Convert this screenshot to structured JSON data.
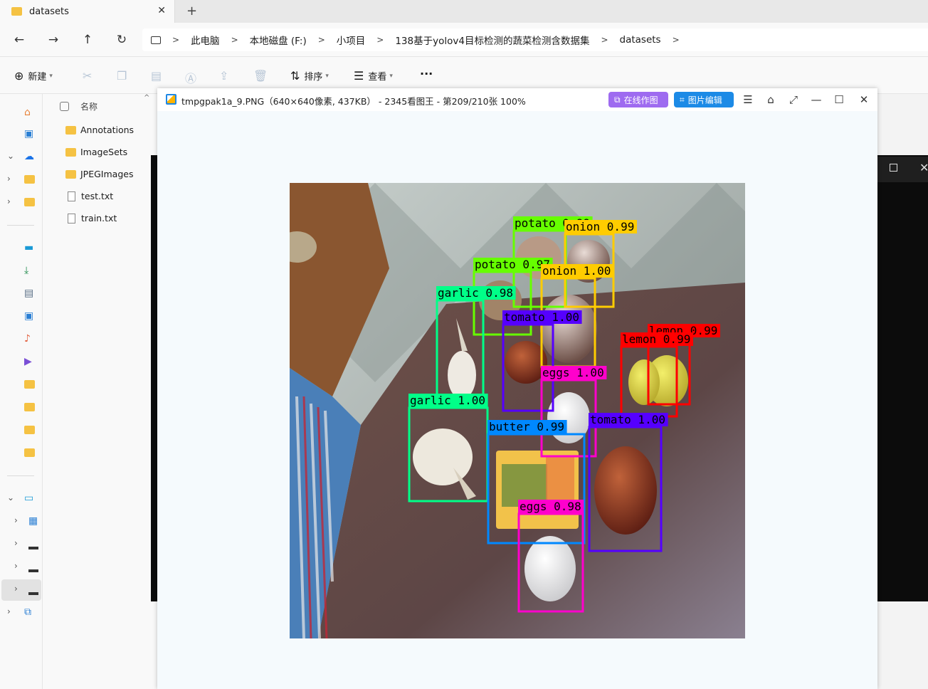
{
  "explorer": {
    "tab_title": "datasets",
    "breadcrumb": [
      "此电脑",
      "本地磁盘 (F:)",
      "小项目",
      "138基于yolov4目标检测的蔬菜检测含数据集",
      "datasets"
    ],
    "commands": {
      "new": "新建",
      "sort": "排序",
      "view": "查看",
      "more": "···"
    },
    "column_name": "名称",
    "files": [
      {
        "name": "Annotations",
        "type": "folder"
      },
      {
        "name": "ImageSets",
        "type": "folder"
      },
      {
        "name": "JPEGImages",
        "type": "folder"
      },
      {
        "name": "test.txt",
        "type": "file"
      },
      {
        "name": "train.txt",
        "type": "file"
      }
    ]
  },
  "viewer": {
    "title": "tmpgpak1a_9.PNG（640×640像素, 437KB） - 2345看图王 - 第209/210张 100%",
    "online_edit": "在线作图",
    "image_edit": "图片编辑"
  },
  "detections": [
    {
      "label": "potato 0.99",
      "color": "#66ff00"
    },
    {
      "label": "onion 0.99",
      "color": "#ffcc00"
    },
    {
      "label": "potato 0.97",
      "color": "#66ff00"
    },
    {
      "label": "onion 1.00",
      "color": "#ffcc00"
    },
    {
      "label": "garlic 0.98",
      "color": "#00ff88"
    },
    {
      "label": "tomato 1.00",
      "color": "#5500ff"
    },
    {
      "label": "lemon 0.99",
      "color": "#ff0000"
    },
    {
      "label": "lemon 0.99",
      "color": "#ff0000"
    },
    {
      "label": "eggs 1.00",
      "color": "#ff00cc"
    },
    {
      "label": "garlic 1.00",
      "color": "#00ff88"
    },
    {
      "label": "butter 0.99",
      "color": "#0088ff"
    },
    {
      "label": "tomato 1.00",
      "color": "#5500ff"
    },
    {
      "label": "eggs 0.98",
      "color": "#ff00cc"
    }
  ]
}
